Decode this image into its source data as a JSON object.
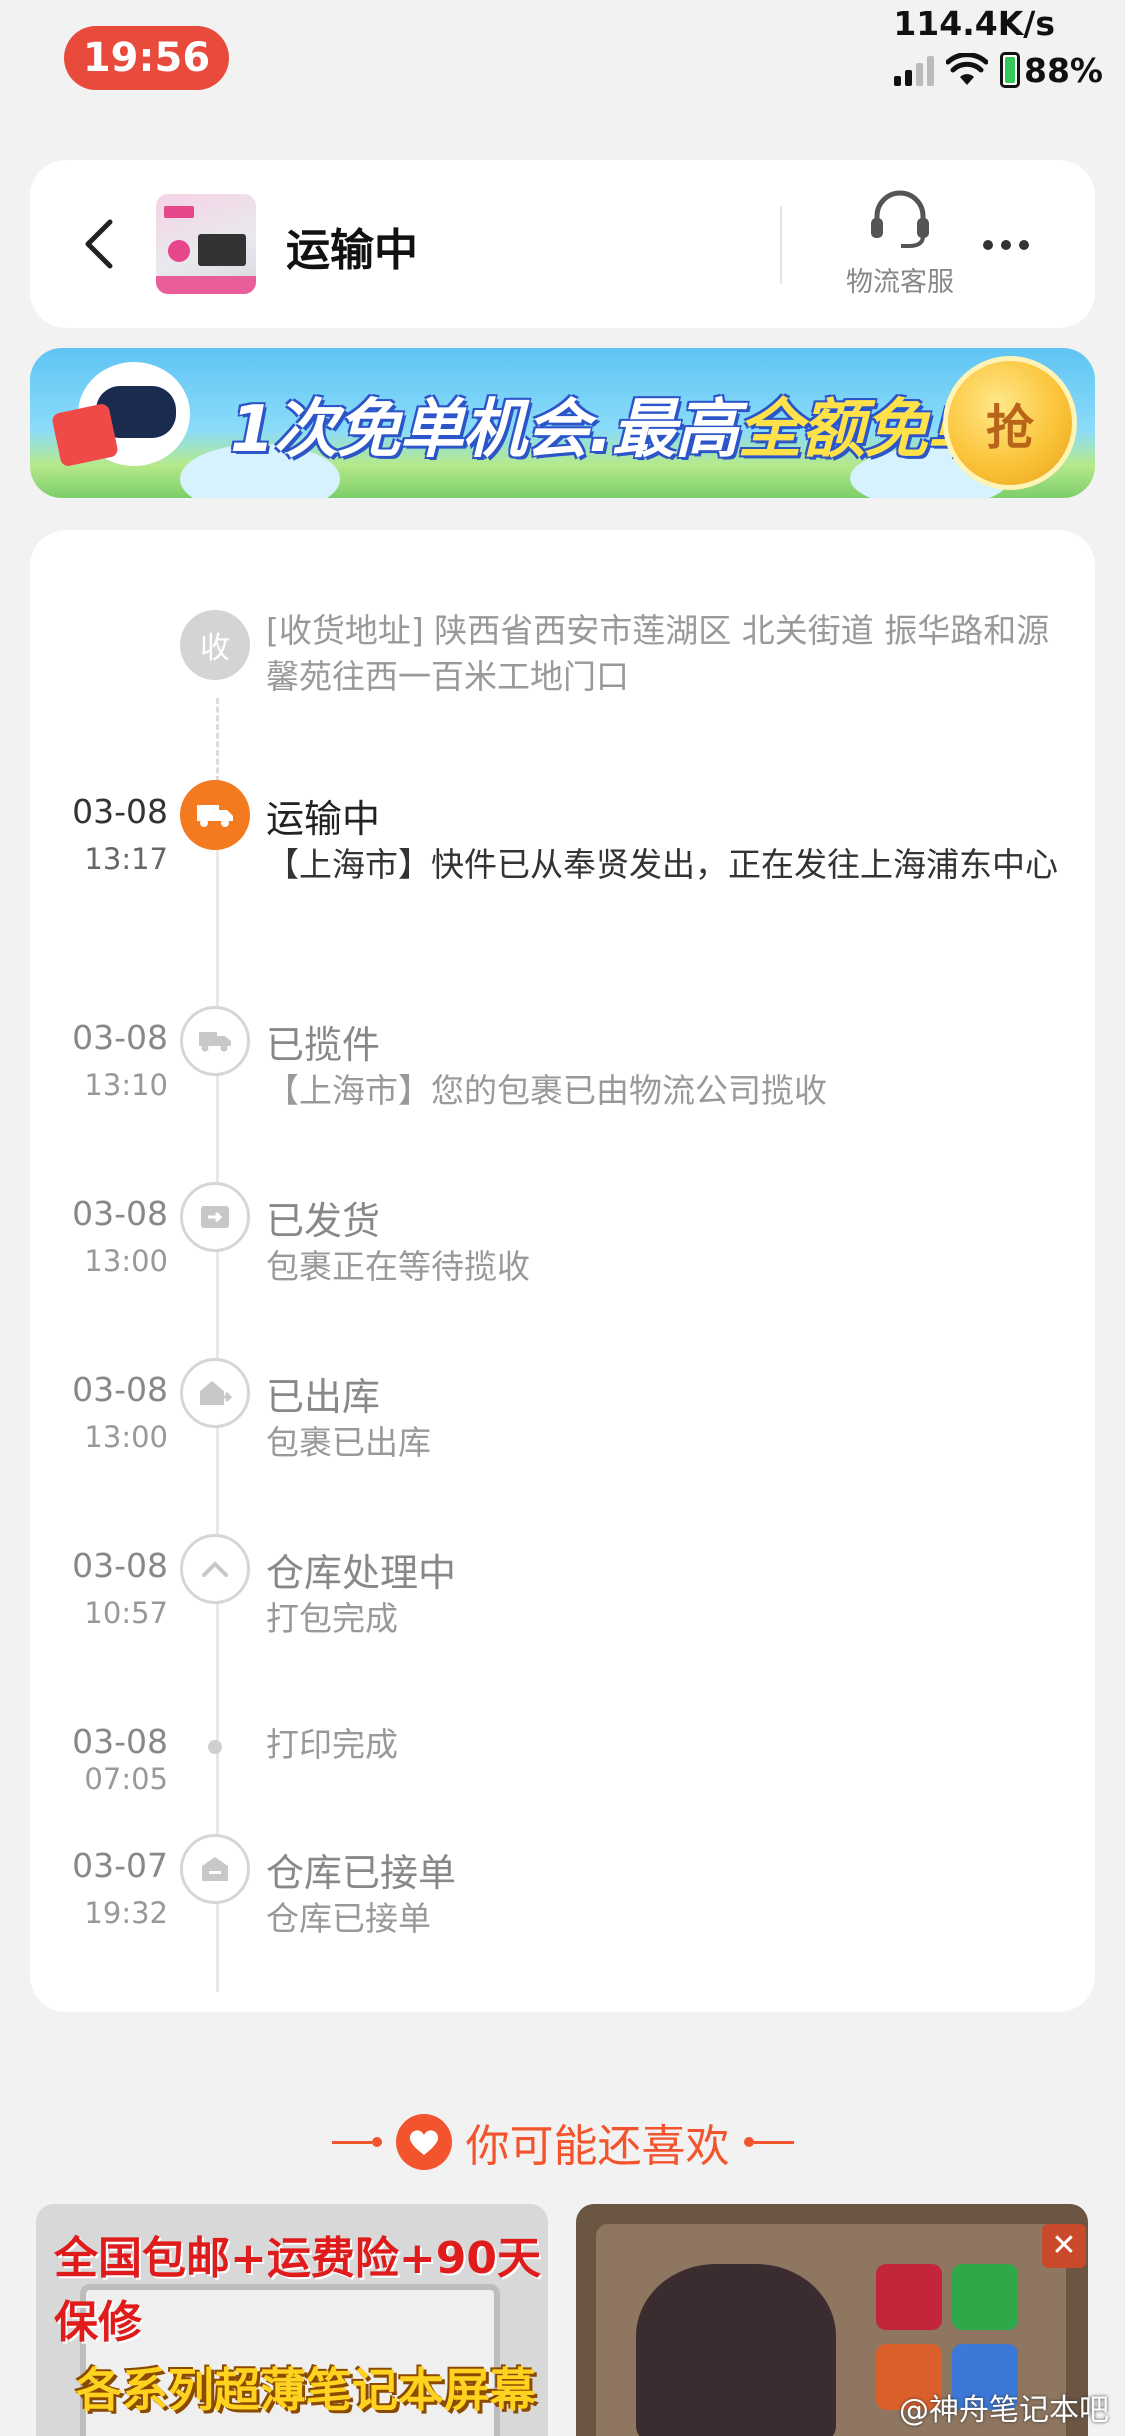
{
  "status_bar": {
    "time": "19:56",
    "net_speed": "114.4K/s",
    "battery": "88%",
    "battery_level": 0.88
  },
  "header": {
    "title": "运输中",
    "service_label": "物流客服",
    "icons": {
      "back": "chevron-left-icon",
      "service": "headset-icon",
      "more": "more-dots-icon"
    }
  },
  "banner": {
    "text_a": "1次免单机会.最高",
    "text_b": "全额免单",
    "button": "抢"
  },
  "timeline": {
    "address": {
      "node_label": "收",
      "text": "[收货地址] 陕西省西安市莲湖区 北关街道 振华路和源馨苑往西一百米工地门口"
    },
    "events": [
      {
        "date": "03-08",
        "time": "13:17",
        "title": "运输中",
        "desc": "【上海市】快件已从奉贤发出，正在发往上海浦东中心",
        "icon": "truck-icon"
      },
      {
        "date": "03-08",
        "time": "13:10",
        "title": "已揽件",
        "desc": "【上海市】您的包裹已由物流公司揽收",
        "icon": "truck-outline-icon"
      },
      {
        "date": "03-08",
        "time": "13:00",
        "title": "已发货",
        "desc": "包裹正在等待揽收",
        "icon": "shipped-box-icon"
      },
      {
        "date": "03-08",
        "time": "13:00",
        "title": "已出库",
        "desc": "包裹已出库",
        "icon": "warehouse-out-icon"
      },
      {
        "date": "03-08",
        "time": "10:57",
        "title": "仓库处理中",
        "desc": "打包完成",
        "icon": "chevron-up-icon"
      },
      {
        "date": "03-08",
        "time": "07:05",
        "title": "",
        "desc": "打印完成",
        "icon": "dot-icon"
      },
      {
        "date": "03-07",
        "time": "19:32",
        "title": "仓库已接单",
        "desc": "仓库已接单",
        "icon": "warehouse-icon"
      }
    ]
  },
  "recommend": {
    "title": "你可能还喜欢",
    "products": [
      {
        "line1": "全国包邮+运费险+90天保修",
        "line2": "各系列超薄笔记本屏幕"
      },
      {
        "watermark": "@神舟笔记本吧"
      }
    ]
  },
  "colors": {
    "accent": "#f47a20",
    "recommend": "#f2542d",
    "time_pill": "#e84a3c"
  }
}
